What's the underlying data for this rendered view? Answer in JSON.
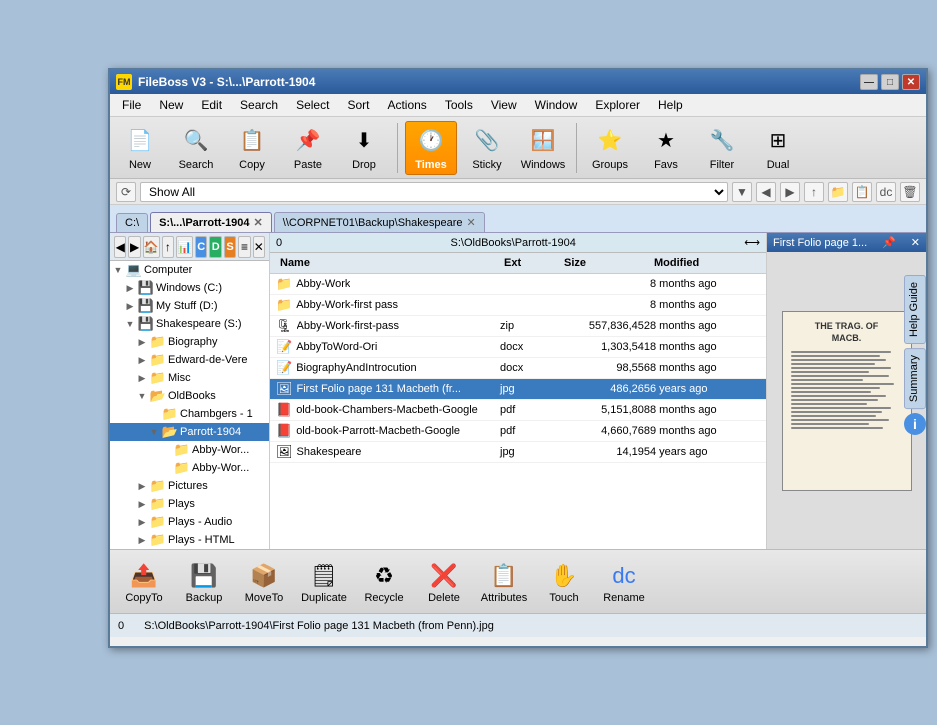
{
  "window": {
    "title": "FileBoss V3 - S:\\...\\Parrott-1904",
    "icon": "FM"
  },
  "titlebar": {
    "minimize": "—",
    "maximize": "□",
    "close": "✕"
  },
  "menu": {
    "items": [
      "File",
      "New",
      "Edit",
      "Search",
      "Select",
      "Sort",
      "Actions",
      "Tools",
      "View",
      "Window",
      "Explorer",
      "Help"
    ]
  },
  "toolbar": {
    "buttons": [
      {
        "id": "new",
        "label": "New",
        "icon": "📄"
      },
      {
        "id": "search",
        "label": "Search",
        "icon": "🔍"
      },
      {
        "id": "copy",
        "label": "Copy",
        "icon": "📋"
      },
      {
        "id": "paste",
        "label": "Paste",
        "icon": "📌"
      },
      {
        "id": "drop",
        "label": "Drop",
        "icon": "⬇"
      },
      {
        "id": "times",
        "label": "Times",
        "icon": "🕐",
        "active": true
      },
      {
        "id": "sticky",
        "label": "Sticky",
        "icon": "📎"
      },
      {
        "id": "windows",
        "label": "Windows",
        "icon": "🪟"
      },
      {
        "id": "groups",
        "label": "Groups",
        "icon": "⭐"
      },
      {
        "id": "favs",
        "label": "Favs",
        "icon": "★"
      },
      {
        "id": "filter",
        "label": "Filter",
        "icon": "🔧"
      },
      {
        "id": "dual",
        "label": "Dual",
        "icon": "⊞"
      }
    ]
  },
  "navbar": {
    "show_all": "Show All",
    "dropdown_arrow": "▼"
  },
  "tabs": [
    {
      "id": "tab1",
      "label": "C:\\",
      "active": false,
      "closeable": false
    },
    {
      "id": "tab2",
      "label": "S:\\...\\Parrott-1904",
      "active": true,
      "closeable": true
    },
    {
      "id": "tab3",
      "label": "\\\\CORPNET01\\Backup\\Shakespeare",
      "active": false,
      "closeable": true
    }
  ],
  "toolbar2": {
    "buttons": [
      "◀",
      "▶",
      "🏠",
      "↑",
      "📊",
      "C",
      "D",
      "S",
      "≡",
      "✕"
    ]
  },
  "path_bar": {
    "number": "0",
    "path": "S:\\OldBooks\\Parrott-1904"
  },
  "file_columns": [
    "Name",
    "Ext",
    "Size",
    "Modified"
  ],
  "files": [
    {
      "name": "Abby-Work",
      "ext": "",
      "size": "",
      "modified": "8 months ago",
      "type": "folder",
      "icon": "📁"
    },
    {
      "name": "Abby-Work-first pass",
      "ext": "",
      "size": "",
      "modified": "8 months ago",
      "type": "folder",
      "icon": "📁"
    },
    {
      "name": "Abby-Work-first-pass",
      "ext": "zip",
      "size": "557,836,452",
      "modified": "8 months ago",
      "type": "zip",
      "icon": "🗜"
    },
    {
      "name": "AbbyToWord-Ori",
      "ext": "docx",
      "size": "1,303,541",
      "modified": "8 months ago",
      "type": "docx",
      "icon": "📝"
    },
    {
      "name": "BiographyAndIntrocution",
      "ext": "docx",
      "size": "98,556",
      "modified": "8 months ago",
      "type": "docx",
      "icon": "📝"
    },
    {
      "name": "First Folio page 131 Macbeth (fr...",
      "ext": "jpg",
      "size": "486,265",
      "modified": "6 years ago",
      "type": "jpg",
      "icon": "🖼",
      "selected": true
    },
    {
      "name": "old-book-Chambers-Macbeth-Google",
      "ext": "pdf",
      "size": "5,151,808",
      "modified": "8 months ago",
      "type": "pdf",
      "icon": "📕"
    },
    {
      "name": "old-book-Parrott-Macbeth-Google",
      "ext": "pdf",
      "size": "4,660,768",
      "modified": "9 months ago",
      "type": "pdf",
      "icon": "📕"
    },
    {
      "name": "Shakespeare",
      "ext": "jpg",
      "size": "14,195",
      "modified": "4 years ago",
      "type": "jpg",
      "icon": "🖼"
    }
  ],
  "tree": {
    "items": [
      {
        "label": "Computer",
        "indent": 0,
        "type": "root",
        "expanded": true
      },
      {
        "label": "Windows (C:)",
        "indent": 1,
        "type": "drive"
      },
      {
        "label": "My Stuff (D:)",
        "indent": 1,
        "type": "drive"
      },
      {
        "label": "Shakespeare (S:)",
        "indent": 1,
        "type": "drive",
        "expanded": true
      },
      {
        "label": "Biography",
        "indent": 2,
        "type": "folder"
      },
      {
        "label": "Edward-de-Vere",
        "indent": 2,
        "type": "folder"
      },
      {
        "label": "Misc",
        "indent": 2,
        "type": "folder"
      },
      {
        "label": "OldBooks",
        "indent": 2,
        "type": "folder",
        "expanded": true
      },
      {
        "label": "Chambgers - 1",
        "indent": 3,
        "type": "folder"
      },
      {
        "label": "Parrott-1904",
        "indent": 3,
        "type": "folder",
        "selected": true,
        "expanded": true
      },
      {
        "label": "Abby-Wor...",
        "indent": 4,
        "type": "folder"
      },
      {
        "label": "Abby-Wor...",
        "indent": 4,
        "type": "folder"
      },
      {
        "label": "Pictures",
        "indent": 2,
        "type": "folder"
      },
      {
        "label": "Plays",
        "indent": 2,
        "type": "folder"
      },
      {
        "label": "Plays - Audio",
        "indent": 2,
        "type": "folder"
      },
      {
        "label": "Plays - HTML",
        "indent": 2,
        "type": "folder"
      }
    ]
  },
  "preview": {
    "title": "First Folio page 1...",
    "book_title": "THE TRAG. OF\nMACB.",
    "lines": [
      8,
      6,
      7,
      5,
      8,
      6,
      7,
      5,
      8,
      6,
      7,
      5,
      8,
      6,
      7,
      5,
      8,
      6,
      7,
      5,
      8,
      6
    ]
  },
  "help_tabs": [
    "Help Guide",
    "Summary"
  ],
  "bottom_toolbar": {
    "buttons": [
      {
        "id": "copyto",
        "label": "CopyTo",
        "icon": "📤"
      },
      {
        "id": "backup",
        "label": "Backup",
        "icon": "💾"
      },
      {
        "id": "moveto",
        "label": "MoveTo",
        "icon": "📦"
      },
      {
        "id": "duplicate",
        "label": "Duplicate",
        "icon": "🗒"
      },
      {
        "id": "recycle",
        "label": "Recycle",
        "icon": "♻"
      },
      {
        "id": "delete",
        "label": "Delete",
        "icon": "❌"
      },
      {
        "id": "attributes",
        "label": "Attributes",
        "icon": "📋"
      },
      {
        "id": "touch",
        "label": "Touch",
        "icon": "✋"
      },
      {
        "id": "rename",
        "label": "Rename",
        "icon": "✏"
      }
    ]
  },
  "status_bar": {
    "count": "0",
    "path": "S:\\OldBooks\\Parrott-1904\\First Folio page 131 Macbeth (from Penn).jpg"
  }
}
